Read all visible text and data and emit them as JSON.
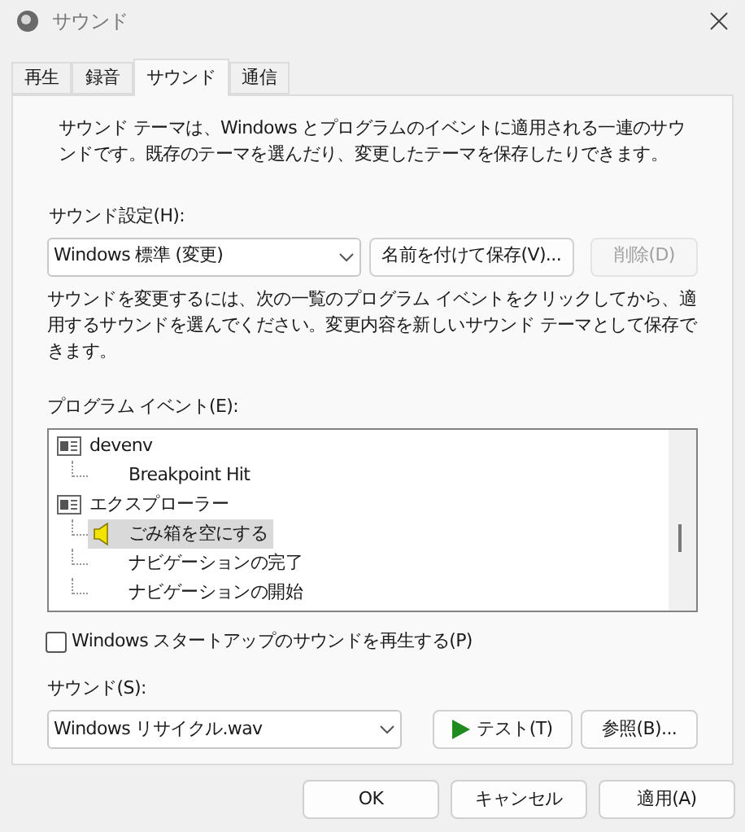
{
  "window": {
    "title": "サウンド"
  },
  "tabs": [
    {
      "label": "再生",
      "selected": false
    },
    {
      "label": "録音",
      "selected": false
    },
    {
      "label": "サウンド",
      "selected": true
    },
    {
      "label": "通信",
      "selected": false
    }
  ],
  "description": "サウンド テーマは、Windows とプログラムのイベントに適用される一連のサウンドです。既存のテーマを選んだり、変更したテーマを保存したりできます。",
  "scheme": {
    "label": "サウンド設定(H):",
    "value": "Windows 標準 (変更)",
    "save_button": "名前を付けて保存(V)...",
    "delete_button": {
      "label": "削除(D)",
      "disabled": true
    }
  },
  "instructions": "サウンドを変更するには、次の一覧のプログラム イベントをクリックしてから、適用するサウンドを選んでください。変更内容を新しいサウンド テーマとして保存できます。",
  "events": {
    "label": "プログラム イベント(E):",
    "items": [
      {
        "label": "devenv",
        "selected": false,
        "children": [
          {
            "label": "Breakpoint Hit",
            "selected": false,
            "has_sound": false
          }
        ]
      },
      {
        "label": "エクスプローラー",
        "selected": false,
        "children": [
          {
            "label": "ごみ箱を空にする",
            "selected": true,
            "has_sound": true
          },
          {
            "label": "ナビゲーションの完了",
            "selected": false,
            "has_sound": false
          },
          {
            "label": "ナビゲーションの開始",
            "selected": false,
            "has_sound": false
          }
        ]
      }
    ]
  },
  "startup": {
    "label": "Windows スタートアップのサウンドを再生する(P)",
    "checked": false
  },
  "sound": {
    "label": "サウンド(S):",
    "value": "Windows リサイクル.wav",
    "test_button": "テスト(T)",
    "browse_button": "参照(B)..."
  },
  "buttons": [
    "OK",
    "キャンセル",
    "適用(A)"
  ]
}
